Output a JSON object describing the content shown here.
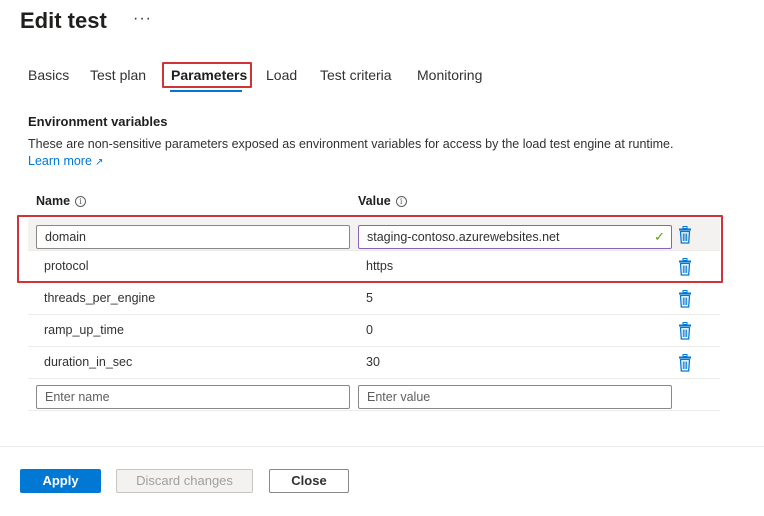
{
  "page": {
    "title": "Edit test",
    "more_label": "···"
  },
  "tabs": [
    {
      "label": "Basics"
    },
    {
      "label": "Test plan"
    },
    {
      "label": "Parameters"
    },
    {
      "label": "Load"
    },
    {
      "label": "Test criteria"
    },
    {
      "label": "Monitoring"
    }
  ],
  "active_tab": "Parameters",
  "section": {
    "title": "Environment variables",
    "description": "These are non-sensitive parameters exposed as environment variables for access by the load test engine at runtime.",
    "learn_more": "Learn more",
    "learn_more_icon": "↗"
  },
  "table": {
    "columns": {
      "name": "Name",
      "value": "Value",
      "info_glyph": "i"
    },
    "rows": [
      {
        "name": "domain",
        "value": "staging-contoso.azurewebsites.net",
        "editing": true
      },
      {
        "name": "protocol",
        "value": "https"
      },
      {
        "name": "threads_per_engine",
        "value": "5"
      },
      {
        "name": "ramp_up_time",
        "value": "0"
      },
      {
        "name": "duration_in_sec",
        "value": "30"
      }
    ],
    "new_row": {
      "name_placeholder": "Enter name",
      "value_placeholder": "Enter value"
    },
    "valid_icon": "✓"
  },
  "footer": {
    "apply": "Apply",
    "discard": "Discard changes",
    "close": "Close"
  },
  "colors": {
    "accent": "#0078d4",
    "highlight": "#d13438",
    "valid": "#57a300",
    "focus": "#8764b8"
  }
}
